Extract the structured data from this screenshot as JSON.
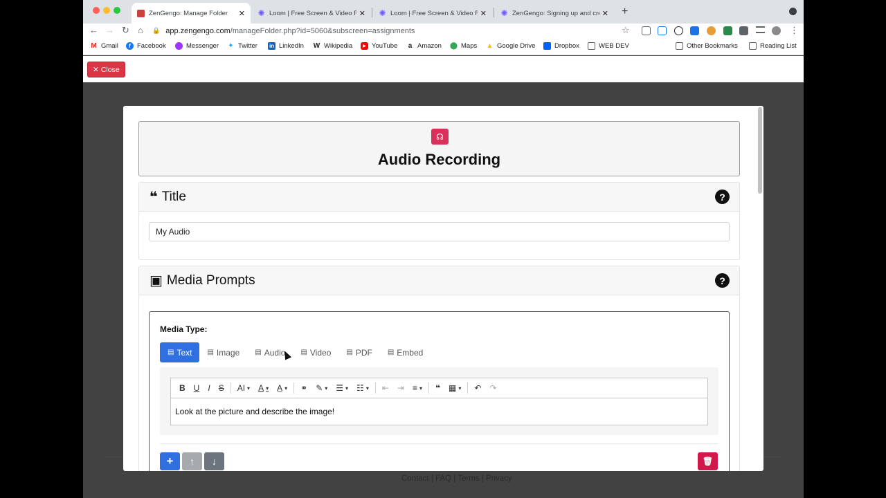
{
  "browser": {
    "tabs": [
      {
        "label": "ZenGengo: Manage Folder",
        "favicon": "zengengo-icon",
        "active": true
      },
      {
        "label": "Loom | Free Screen & Video Re",
        "favicon": "loom-icon",
        "active": false
      },
      {
        "label": "Loom | Free Screen & Video Re",
        "favicon": "loom-icon",
        "active": false
      },
      {
        "label": "ZenGengo: Signing up and cre",
        "favicon": "loom-icon",
        "active": false
      }
    ],
    "url_host": "app.zengengo.com",
    "url_path": "/manageFolder.php?id=5060&subscreen=assignments",
    "bookmarks": [
      "Gmail",
      "Facebook",
      "Messenger",
      "Twitter",
      "LinkedIn",
      "Wikipedia",
      "YouTube",
      "Amazon",
      "Maps",
      "Google Drive",
      "Dropbox",
      "WEB DEV"
    ],
    "other_bookmarks": "Other Bookmarks",
    "reading_list": "Reading List"
  },
  "page": {
    "close_label": "Close",
    "footer": {
      "contact": "Contact",
      "faq": "FAQ",
      "terms": "Terms",
      "privacy": "Privacy",
      "separator": "|"
    }
  },
  "modal": {
    "title": "Audio Recording",
    "title_section": {
      "heading": "Title",
      "input_value": "My Audio"
    },
    "media_section": {
      "heading": "Media Prompts",
      "media_type_label": "Media Type:",
      "tabs": [
        "Text",
        "Image",
        "Audio",
        "Video",
        "PDF",
        "Embed"
      ],
      "active_tab": "Text",
      "editor_content": "Look at the picture and describe the image!"
    }
  },
  "colors": {
    "primary": "#2f6fe0",
    "danger": "#d0194a",
    "close": "#dc3545"
  }
}
